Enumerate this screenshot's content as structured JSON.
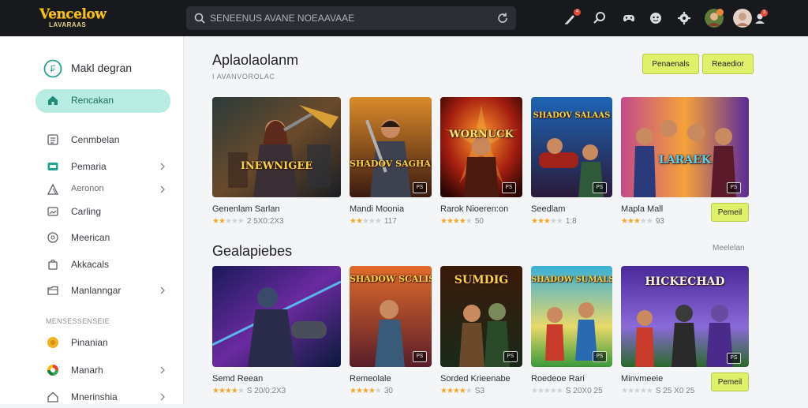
{
  "header": {
    "logo_line1": "Vencelow",
    "logo_line2": "LAVARAAS",
    "search_placeholder": "SENEENUS AVANE NOEAAVAAE",
    "notif_badge": "4",
    "profile_badge": "3"
  },
  "sidebar": {
    "heading": "Makl degran",
    "section_label": "MENSESSENSEIE",
    "items": [
      {
        "label": "Rencakan",
        "icon": "home-icon",
        "active": true,
        "chevron": false
      },
      {
        "label": "Cenmbelan",
        "icon": "list-icon",
        "active": false,
        "chevron": false
      },
      {
        "label": "Pemaria",
        "icon": "gamepad-icon",
        "active": false,
        "chevron": true
      },
      {
        "label": "Aeronon",
        "icon": "triangle-icon",
        "active": false,
        "chevron": true
      },
      {
        "label": "Carling",
        "icon": "image-icon",
        "active": false,
        "chevron": false
      },
      {
        "label": "Meerican",
        "icon": "help-circle-icon",
        "active": false,
        "chevron": false
      },
      {
        "label": "Akkacals",
        "icon": "bag-icon",
        "active": false,
        "chevron": false
      },
      {
        "label": "Manlanngar",
        "icon": "folder-icon",
        "active": false,
        "chevron": true
      },
      {
        "label": "Pinanian",
        "icon": "coin-icon",
        "active": false,
        "chevron": false
      },
      {
        "label": "Manarh",
        "icon": "google-icon",
        "active": false,
        "chevron": true
      },
      {
        "label": "Mnerinshia",
        "icon": "home-outline-icon",
        "active": false,
        "chevron": true
      }
    ]
  },
  "section1": {
    "title": "Aplaolaolanm",
    "subtitle": "I AVANVOROLAC",
    "buttons": [
      "Penaenals",
      "Reaedior"
    ],
    "games": [
      {
        "name": "Genenlam Sarlan",
        "stars": 2,
        "reviews": "2 5X0:2X3",
        "thumb_title": "INEWNIGEE",
        "platform": ""
      },
      {
        "name": "Mandi Moonia",
        "stars": 2,
        "reviews": "117",
        "thumb_title": "SHADOV SAGHAES",
        "platform": "PS"
      },
      {
        "name": "Rarok Nioeren:on",
        "stars": 4,
        "reviews": "50",
        "thumb_title": "WORNUCK",
        "platform": "PS"
      },
      {
        "name": "Seedlam",
        "stars": 3,
        "reviews": "1:8",
        "thumb_title": "SHADOV SALAAS",
        "platform": "PS"
      },
      {
        "name": "Mapla Mall",
        "stars": 3,
        "reviews": "93",
        "thumb_title": "LARAEK",
        "platform": "PS"
      }
    ],
    "card_button": "Pemeil"
  },
  "section2": {
    "title": "Gealapiebes",
    "see_all": "Meelelan",
    "games": [
      {
        "name": "Semd Reean",
        "stars": 4,
        "reviews": "S 20/0:2X3",
        "thumb_title": "",
        "platform": ""
      },
      {
        "name": "Remeolale",
        "stars": 4,
        "reviews": "30",
        "thumb_title": "SHADOW SCALIS",
        "platform": "PS"
      },
      {
        "name": "Sorded Krieenabe",
        "stars": 4,
        "reviews": "S3",
        "thumb_title": "SUMDIG",
        "platform": "PS"
      },
      {
        "name": "Roedeoe Rari",
        "stars": 0,
        "reviews": "S 20X0 25",
        "thumb_title": "SHADOW SUMALS",
        "platform": "PS"
      },
      {
        "name": "Minvmeeie",
        "stars": 0,
        "reviews": "S 25 X0 25",
        "thumb_title": "HICKECHAD",
        "platform": "PS"
      }
    ],
    "card_button": "Pemeil"
  },
  "colors": {
    "topbar": "#17191d",
    "accent_yellow": "#dff06a",
    "active_nav": "#b7ece3",
    "star": "#f0a92b"
  }
}
